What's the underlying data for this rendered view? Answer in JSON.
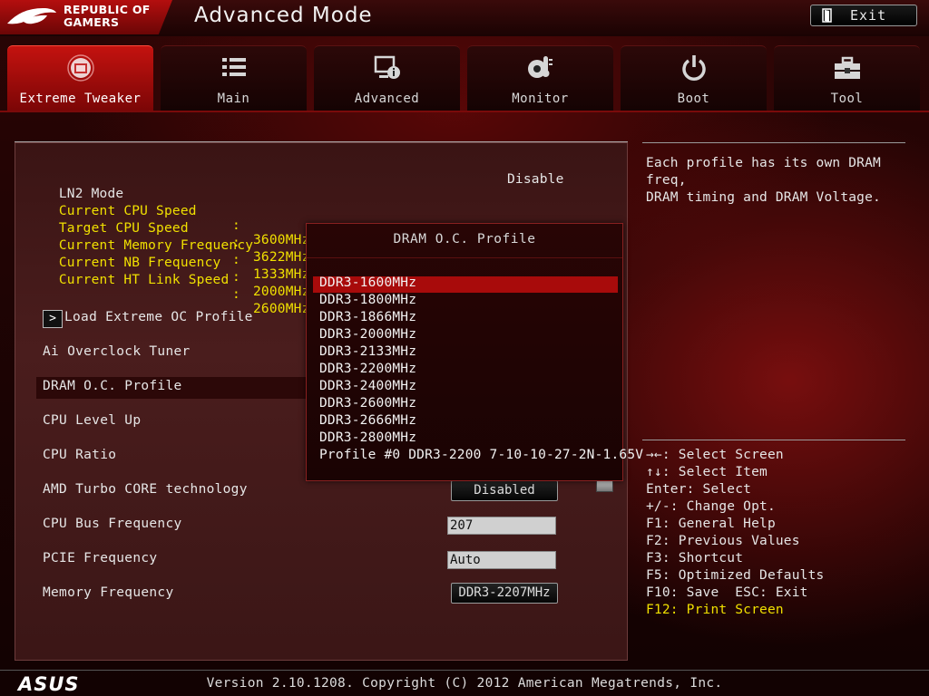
{
  "header": {
    "brand_line1": "REPUBLIC OF",
    "brand_line2": "GAMERS",
    "title": "Advanced Mode",
    "exit_label": "Exit"
  },
  "tabs": [
    {
      "label": "Extreme Tweaker",
      "icon": "tweaker-icon",
      "active": true
    },
    {
      "label": "Main",
      "icon": "list-icon",
      "active": false
    },
    {
      "label": "Advanced",
      "icon": "advanced-info-icon",
      "active": false
    },
    {
      "label": "Monitor",
      "icon": "thermometer-gear-icon",
      "active": false
    },
    {
      "label": "Boot",
      "icon": "power-icon",
      "active": false
    },
    {
      "label": "Tool",
      "icon": "toolbox-icon",
      "active": false
    }
  ],
  "info": {
    "ln2_label": "LN2 Mode",
    "ln2_value": "Disable",
    "rows": [
      {
        "label": "Current CPU Speed",
        "value": "3600MHz"
      },
      {
        "label": "Target CPU Speed",
        "value": "3622MHz"
      },
      {
        "label": "Current Memory Frequency",
        "value": "1333MHz"
      },
      {
        "label": "Current NB Frequency",
        "value": "2000MHz"
      },
      {
        "label": "Current HT Link Speed",
        "value": "2600MHz"
      }
    ]
  },
  "items": {
    "load_profile": "Load Extreme OC Profile",
    "ai_tuner": "Ai Overclock Tuner",
    "dram_profile": "DRAM O.C. Profile",
    "cpu_level_up": "CPU Level Up",
    "cpu_ratio": "CPU Ratio",
    "amd_turbo": "AMD Turbo CORE technology",
    "amd_turbo_value": "Disabled",
    "cpu_bus": "CPU Bus Frequency",
    "cpu_bus_value": "207",
    "pcie": "PCIE Frequency",
    "pcie_value": "Auto",
    "memory_freq": "Memory Frequency",
    "memory_freq_value": "DDR3-2207MHz"
  },
  "popup": {
    "title": "DRAM O.C. Profile",
    "selected_index": 0,
    "options": [
      "DDR3-1600MHz",
      "DDR3-1800MHz",
      "DDR3-1866MHz",
      "DDR3-2000MHz",
      "DDR3-2133MHz",
      "DDR3-2200MHz",
      "DDR3-2400MHz",
      "DDR3-2600MHz",
      "DDR3-2666MHz",
      "DDR3-2800MHz",
      "Profile #0 DDR3-2200 7-10-10-27-2N-1.65V"
    ]
  },
  "help": {
    "line1": "Each profile has its own DRAM freq,",
    "line2": "DRAM timing and DRAM Voltage."
  },
  "keys": [
    "→←: Select Screen",
    "↑↓: Select Item",
    "Enter: Select",
    "+/-: Change Opt.",
    "F1: General Help",
    "F2: Previous Values",
    "F3: Shortcut",
    "F5: Optimized Defaults",
    "F10: Save  ESC: Exit",
    "F12: Print Screen"
  ],
  "footer": {
    "brand": "ASUS",
    "version": "Version 2.10.1208. Copyright (C) 2012 American Megatrends, Inc."
  },
  "colors": {
    "accent_red": "#c4120f",
    "info_yellow": "#f0e000",
    "popup_selection": "#a80b0b"
  }
}
